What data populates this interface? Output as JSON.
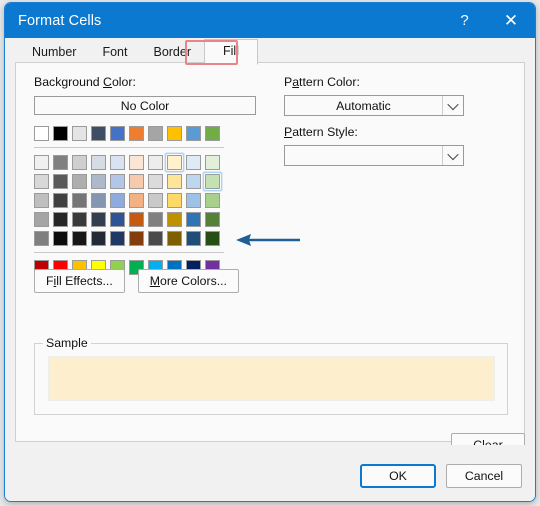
{
  "window": {
    "title": "Format Cells",
    "help_icon": "question-mark-icon",
    "help_label": "?",
    "close_label": "✕",
    "titlebar_color": "#0b79d0"
  },
  "tabs": [
    {
      "label": "Number",
      "active": false
    },
    {
      "label": "Font",
      "active": false
    },
    {
      "label": "Border",
      "active": false
    },
    {
      "label": "Fill",
      "active": true
    }
  ],
  "annotations": {
    "tab_highlight_color": "#e8858b",
    "arrow_color": "#1f5f96",
    "arrow_direction": "left",
    "arrow_points_to": "background-color-palette"
  },
  "background_color": {
    "label": "Background Color:",
    "label_prefix": "Background ",
    "label_accel": "C",
    "label_suffix": "olor:",
    "no_color_label": "No Color"
  },
  "palette": {
    "theme_header_row": [
      "#ffffff",
      "#000000",
      "#e4e4e4",
      "#404e63",
      "#4472c4",
      "#ed7d31",
      "#a5a5a5",
      "#ffc000",
      "#5b9bd5",
      "#70ad47"
    ],
    "theme_tint_rows": [
      [
        "#f0f0f0",
        "#808080",
        "#cfcfcf",
        "#d6dce4",
        "#d9e2f3",
        "#fbe5d5",
        "#ededed",
        "#fff2cc",
        "#deebf6",
        "#e2efd9"
      ],
      [
        "#d8d8d8",
        "#595959",
        "#aeaeae",
        "#adb9ca",
        "#b4c6e7",
        "#f7caac",
        "#dbdbdb",
        "#ffe598",
        "#bdd7ee",
        "#c5e0b3"
      ],
      [
        "#bfbfbf",
        "#404040",
        "#757575",
        "#8496b0",
        "#8faadc",
        "#f4b183",
        "#c9c9c9",
        "#ffd965",
        "#9cc3e5",
        "#a8d08d"
      ],
      [
        "#a5a5a5",
        "#262626",
        "#3a3a3a",
        "#333f4f",
        "#2f5496",
        "#c55a11",
        "#808080",
        "#bf9000",
        "#2e75b5",
        "#538135"
      ],
      [
        "#7f7f7f",
        "#0c0c0c",
        "#171717",
        "#222a35",
        "#1f3864",
        "#833c0b",
        "#4a4a4a",
        "#7f6000",
        "#1f4e79",
        "#274e13"
      ]
    ],
    "standard_row": [
      "#c00000",
      "#ff0000",
      "#ffc000",
      "#ffff00",
      "#92d050",
      "#00b050",
      "#00b0f0",
      "#0070c0",
      "#002060",
      "#7030a0"
    ],
    "selected": [
      {
        "row": 0,
        "col": 7,
        "color": "#fff2cc"
      },
      {
        "row": 1,
        "col": 9,
        "color": "#c5e0b3"
      }
    ],
    "selection_ring_color": "#a8d4f2"
  },
  "pattern_color": {
    "label": "Pattern Color:",
    "label_prefix": "P",
    "label_accel": "a",
    "label_suffix": "ttern Color:",
    "value": "Automatic",
    "icon": "chevron-down-icon"
  },
  "pattern_style": {
    "label": "Pattern Style:",
    "label_prefix": "",
    "label_accel": "P",
    "label_suffix": "attern Style:",
    "value": "",
    "icon": "chevron-down-icon"
  },
  "effect_buttons": {
    "fill_effects": {
      "prefix": "F",
      "accel": "i",
      "suffix": "ll Effects..."
    },
    "more_colors": {
      "prefix": "",
      "accel": "M",
      "suffix": "ore Colors..."
    }
  },
  "sample": {
    "group_label": "Sample",
    "fill_color": "#fdefcd"
  },
  "clear_button": {
    "prefix": "Clea",
    "accel": "r",
    "suffix": ""
  },
  "footer_buttons": {
    "ok": "OK",
    "cancel": "Cancel",
    "default": "ok"
  }
}
